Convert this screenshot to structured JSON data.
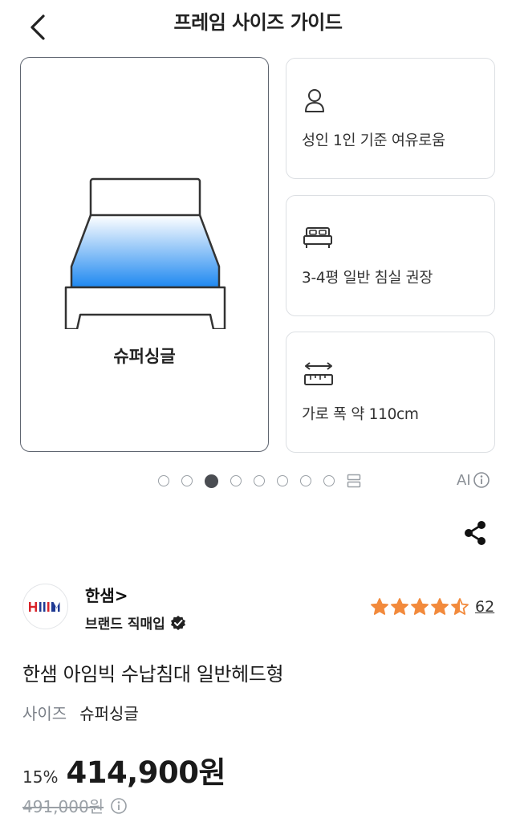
{
  "header": {
    "title": "프레임 사이즈 가이드"
  },
  "size_card": {
    "label": "슈퍼싱글"
  },
  "info_cards": [
    {
      "icon": "person-icon",
      "text": "성인 1인 기준 여유로움"
    },
    {
      "icon": "bed-icon",
      "text": "3-4평 일반 침실 권장"
    },
    {
      "icon": "ruler-icon",
      "text": "가로 폭 약 110cm"
    }
  ],
  "pager": {
    "total": 8,
    "active_index": 2
  },
  "ai_badge": "AI",
  "brand": {
    "name": "한샘>",
    "tag": "브랜드 직매입",
    "logo_text": "HIM"
  },
  "rating": {
    "value": 4.5,
    "max": 5,
    "count": "62"
  },
  "product": {
    "title": "한샘 아임빅 수납침대 일반헤드형"
  },
  "option": {
    "label": "사이즈",
    "value": "슈퍼싱글"
  },
  "price": {
    "discount": "15%",
    "sale": "414,900원",
    "original": "491,000원"
  },
  "colors": {
    "star": "#f28a3c",
    "bed_gradient_top": "#ffffff",
    "bed_gradient_bottom": "#1e88f0",
    "logo_red": "#d9232a",
    "logo_blue": "#1f3a93"
  }
}
